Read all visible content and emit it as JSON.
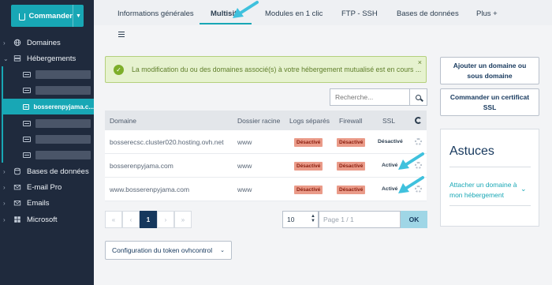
{
  "sidebar": {
    "commander_label": "Commander",
    "items": [
      {
        "label": "Domaines",
        "icon": "globe-icon"
      },
      {
        "label": "Hébergements",
        "icon": "hosting-icon"
      },
      {
        "label": "Bases de données",
        "icon": "database-icon"
      },
      {
        "label": "E-mail Pro",
        "icon": "mail-icon"
      },
      {
        "label": "Emails",
        "icon": "mail-icon"
      },
      {
        "label": "Microsoft",
        "icon": "windows-icon"
      }
    ],
    "hosting_active": "bosserenpyjama.c..."
  },
  "tabs": [
    {
      "label": "Informations générales"
    },
    {
      "label": "Multisite"
    },
    {
      "label": "Modules en 1 clic"
    },
    {
      "label": "FTP - SSH"
    },
    {
      "label": "Bases de données"
    },
    {
      "label": "Plus +"
    }
  ],
  "alert": {
    "message": "La modification du ou des domaines associé(s) à votre hébergement mutualisé est en cours ...",
    "close": "×"
  },
  "search": {
    "placeholder": "Recherche..."
  },
  "table": {
    "headers": [
      "Domaine",
      "Dossier racine",
      "Logs séparés",
      "Firewall",
      "SSL"
    ],
    "rows": [
      {
        "domain": "bosserecsc.cluster020.hosting.ovh.net",
        "root": "www",
        "logs": "Désactivé",
        "firewall": "Désactivé",
        "ssl": "Désactivé"
      },
      {
        "domain": "bosserenpyjama.com",
        "root": "www",
        "logs": "Désactivé",
        "firewall": "Désactivé",
        "ssl": "Activé"
      },
      {
        "domain": "www.bosserenpyjama.com",
        "root": "www",
        "logs": "Désactivé",
        "firewall": "Désactivé",
        "ssl": "Activé"
      }
    ]
  },
  "pagination": {
    "first": "«",
    "prev": "‹",
    "current": "1",
    "next": "›",
    "last": "»",
    "page_size": "10",
    "page_label": "Page 1 / 1",
    "ok": "OK"
  },
  "token_button": "Configuration du token ovhcontrol",
  "right": {
    "add_domain": "Ajouter un domaine ou sous domaine",
    "order_ssl": "Commander un certificat SSL",
    "tips_title": "Astuces",
    "tips_link": "Attacher un domaine à mon hébergement"
  },
  "colors": {
    "accent": "#18a7b5",
    "navy": "#16385d",
    "sidebar": "#1f2a3d",
    "badge": "#ea9b89",
    "arrow": "#3fc1dd"
  }
}
